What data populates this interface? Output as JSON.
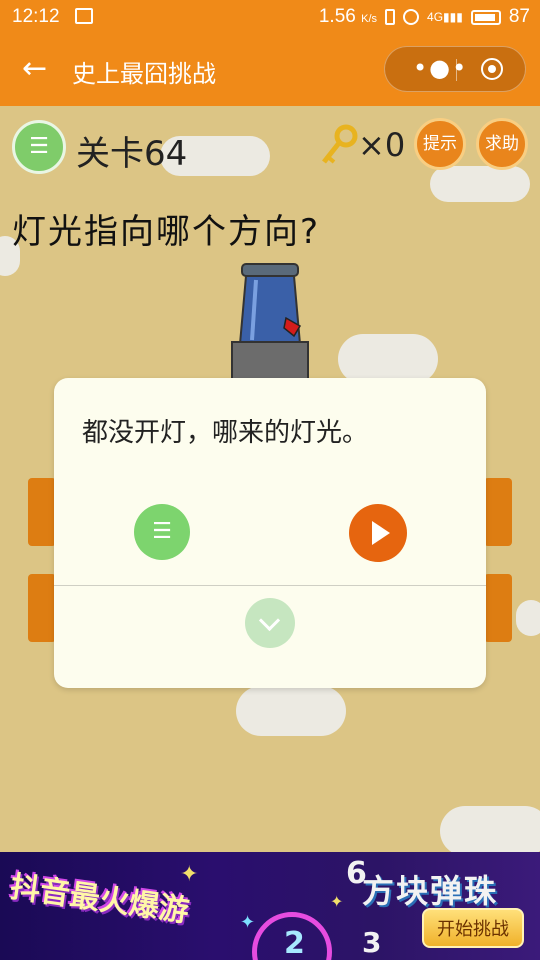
{
  "status_bar": {
    "time": "12:12",
    "network_speed": "1.56",
    "network_unit": "K/s",
    "signal": "4G",
    "battery": "87"
  },
  "title_bar": {
    "title": "史上最囧挑战",
    "more_icon": "ellipsis-icon",
    "close_icon": "target-icon"
  },
  "game": {
    "level_label": "关卡64",
    "key_count": "×0",
    "hint_label": "提示",
    "help_label": "求助",
    "question": "灯光指向哪个方向?"
  },
  "dialog": {
    "message": "都没开灯，哪来的灯光。",
    "list_icon": "list-icon",
    "play_icon": "play-icon",
    "collapse_icon": "chevron-down-icon"
  },
  "ad": {
    "left_text": "抖音最火爆游",
    "right_text": "方块弹珠",
    "cta": "开始挑战",
    "numbers": [
      "6",
      "2",
      "3"
    ]
  },
  "colors": {
    "accent": "#f08a18",
    "background": "#dcc585",
    "dialog_bg": "#fdfdee",
    "play_button": "#e6650f",
    "list_button": "#7dd46e"
  }
}
